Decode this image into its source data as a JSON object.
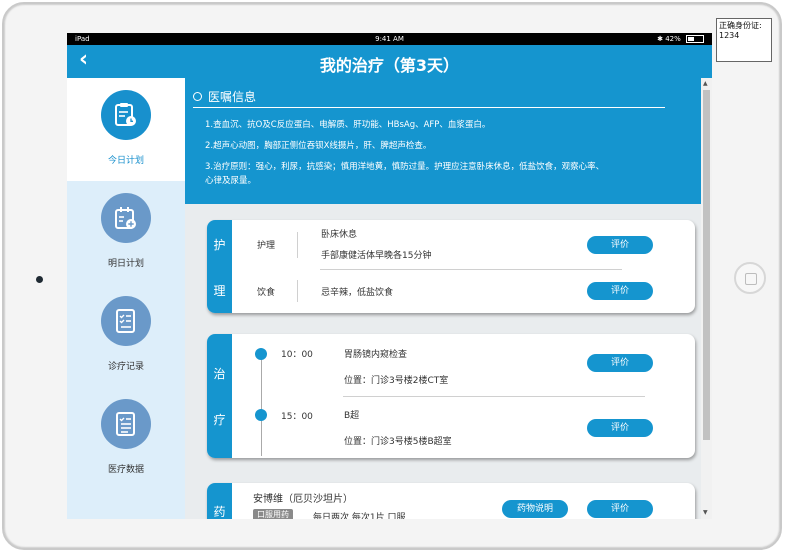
{
  "note": {
    "line1": "正确身份证:",
    "line2": "1234"
  },
  "statusbar": {
    "device": "iPad",
    "time": "9:41 AM",
    "battery": "42%",
    "battery_level": 0.42
  },
  "header": {
    "title": "我的治疗（第3天）",
    "back_glyph": "‹"
  },
  "sidebar": {
    "items": [
      {
        "label": "今日计划",
        "icon": "clipboard-clock-icon",
        "active": true
      },
      {
        "label": "明日计划",
        "icon": "calendar-plus-icon",
        "active": false
      },
      {
        "label": "诊疗记录",
        "icon": "checklist-icon",
        "active": false
      },
      {
        "label": "医疗数据",
        "icon": "list-data-icon",
        "active": false
      }
    ]
  },
  "orders": {
    "title": "医嘱信息",
    "items": [
      "1.查血沉、抗O及C反应蛋白、电解质、肝功能、HBsAg、AFP、血浆蛋白。",
      "2.超声心动图，胸部正侧位吞钡X线摄片，肝、脾超声检查。",
      "3.治疗原则：强心，利尿，抗感染；慎用洋地黄，慎防过量。护理应注意卧床休息，低盐饮食，观察心率、",
      "心律及尿量。"
    ]
  },
  "nursing": {
    "tab": [
      "护",
      "理"
    ],
    "rows": [
      {
        "category": "护理",
        "line1": "卧床休息",
        "line2": "手部康健活体早晚各15分钟",
        "button": "评价"
      },
      {
        "category": "饮食",
        "line1": "忌辛辣，低盐饮食",
        "button": "评价"
      }
    ]
  },
  "treatment": {
    "tab": [
      "治",
      "疗"
    ],
    "rows": [
      {
        "time": "10：00",
        "title": "胃肠镜内窥检查",
        "location": "位置：门诊3号楼2楼CT室",
        "button": "评价"
      },
      {
        "time": "15：00",
        "title": "B超",
        "location": "位置：门诊3号楼5楼B超室",
        "button": "评价"
      }
    ]
  },
  "medicine": {
    "tab": [
      "药"
    ],
    "name": "安博维（厄贝沙坦片）",
    "tag": "口服用药",
    "dosage": "每日两次    每次1片    口服",
    "info_button": "药物说明",
    "button": "评价"
  },
  "colors": {
    "primary": "#1595cf",
    "sidebar_bg": "#ddeefa",
    "icon_inactive": "#6a99c9"
  }
}
